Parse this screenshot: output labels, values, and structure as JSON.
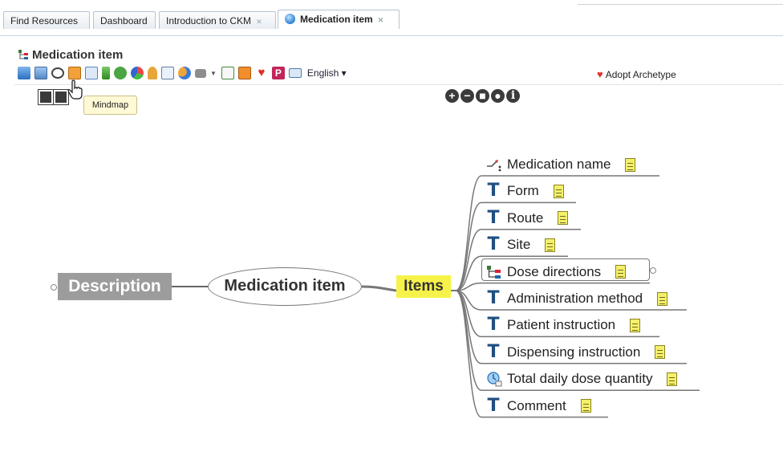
{
  "tabs": [
    {
      "label": "Find Resources"
    },
    {
      "label": "Dashboard"
    },
    {
      "label": "Introduction to CKM",
      "closable": true
    },
    {
      "label": "Medication item",
      "closable": true,
      "active": true
    }
  ],
  "archetype": {
    "title": "Medication item"
  },
  "toolbar": {
    "language": "English ▾",
    "adopt_label": "Adopt Archetype",
    "tooltip": "Mindmap"
  },
  "mindmap": {
    "root": "Description",
    "center": "Medication item",
    "branch": "Items",
    "leaves": [
      {
        "label": "Medication name",
        "icon": "quantity-icon"
      },
      {
        "label": "Form",
        "icon": "text-icon"
      },
      {
        "label": "Route",
        "icon": "text-icon"
      },
      {
        "label": "Site",
        "icon": "text-icon"
      },
      {
        "label": "Dose directions",
        "icon": "cluster-icon"
      },
      {
        "label": "Administration method",
        "icon": "text-icon"
      },
      {
        "label": "Patient instruction",
        "icon": "text-icon"
      },
      {
        "label": "Dispensing instruction",
        "icon": "text-icon"
      },
      {
        "label": "Total daily dose quantity",
        "icon": "quantity-icon"
      },
      {
        "label": "Comment",
        "icon": "text-icon"
      }
    ]
  },
  "colors": {
    "items_node": "#f7f24a",
    "description_node": "#9c9c9c",
    "text_icon": "#1f4f82",
    "adopt_heart": "#e0302d"
  }
}
